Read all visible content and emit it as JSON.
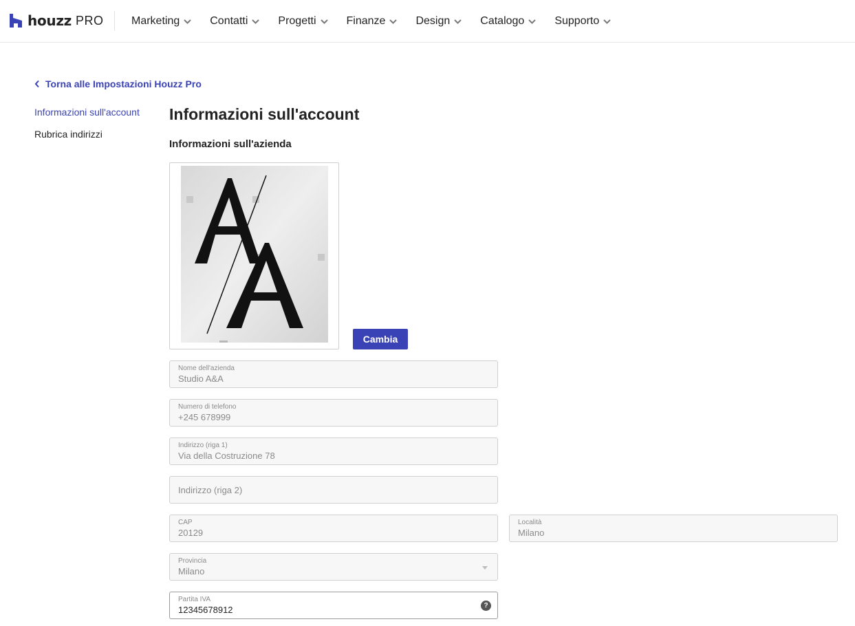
{
  "header": {
    "brand": "houzz",
    "brand_suffix": "PRO",
    "nav": [
      {
        "label": "Marketing"
      },
      {
        "label": "Contatti"
      },
      {
        "label": "Progetti"
      },
      {
        "label": "Finanze"
      },
      {
        "label": "Design"
      },
      {
        "label": "Catalogo"
      },
      {
        "label": "Supporto"
      }
    ]
  },
  "back_link": "Torna alle Impostazioni Houzz Pro",
  "sidenav": {
    "items": [
      {
        "label": "Informazioni sull'account",
        "active": true
      },
      {
        "label": "Rubrica indirizzi",
        "active": false
      }
    ]
  },
  "main": {
    "title": "Informazioni sull'account",
    "section": "Informazioni sull'azienda",
    "logo_text": "A/A",
    "change_button": "Cambia",
    "fields": {
      "company": {
        "label": "Nome dell'azienda",
        "value": "Studio A&A"
      },
      "phone": {
        "label": "Numero di telefono",
        "value": "+245 678999"
      },
      "address1": {
        "label": "Indirizzo (riga 1)",
        "value": "Via della Costruzione 78"
      },
      "address2": {
        "placeholder": "Indirizzo (riga 2)"
      },
      "cap": {
        "label": "CAP",
        "value": "20129"
      },
      "city": {
        "label": "Località",
        "value": "Milano"
      },
      "province": {
        "label": "Provincia",
        "value": "Milano"
      },
      "vat": {
        "label": "Partita IVA",
        "value": "12345678912",
        "help": "?"
      }
    }
  },
  "colors": {
    "accent": "#3a43b6",
    "field_bg": "#f7f7f7",
    "border": "#cfcfcf"
  }
}
